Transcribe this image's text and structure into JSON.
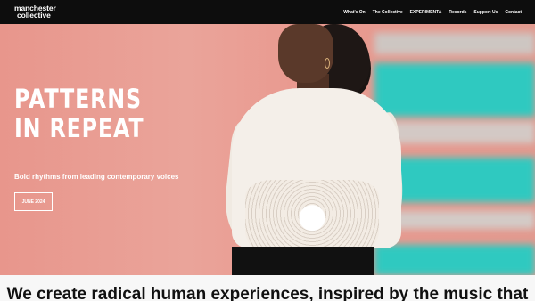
{
  "header": {
    "logo_line1": "manchester",
    "logo_line2": "collective",
    "nav": [
      "What's On",
      "The Collective",
      "EXPERIMENTA",
      "Records",
      "Support Us",
      "Contact"
    ]
  },
  "hero": {
    "title_line1": "PATTERNS",
    "title_line2": "IN REPEAT",
    "subtitle": "Bold rhythms from leading contemporary voices",
    "button_label": "JUNE 2024"
  },
  "intro": {
    "tagline": "We create radical human experiences, inspired by the music that"
  },
  "colors": {
    "topbar": "#0d0d0d",
    "hero_bg": "#e89c92",
    "stripe_teal": "#2ec8bf",
    "stripe_grey": "#cfcac6",
    "text_light": "#ffffff"
  }
}
